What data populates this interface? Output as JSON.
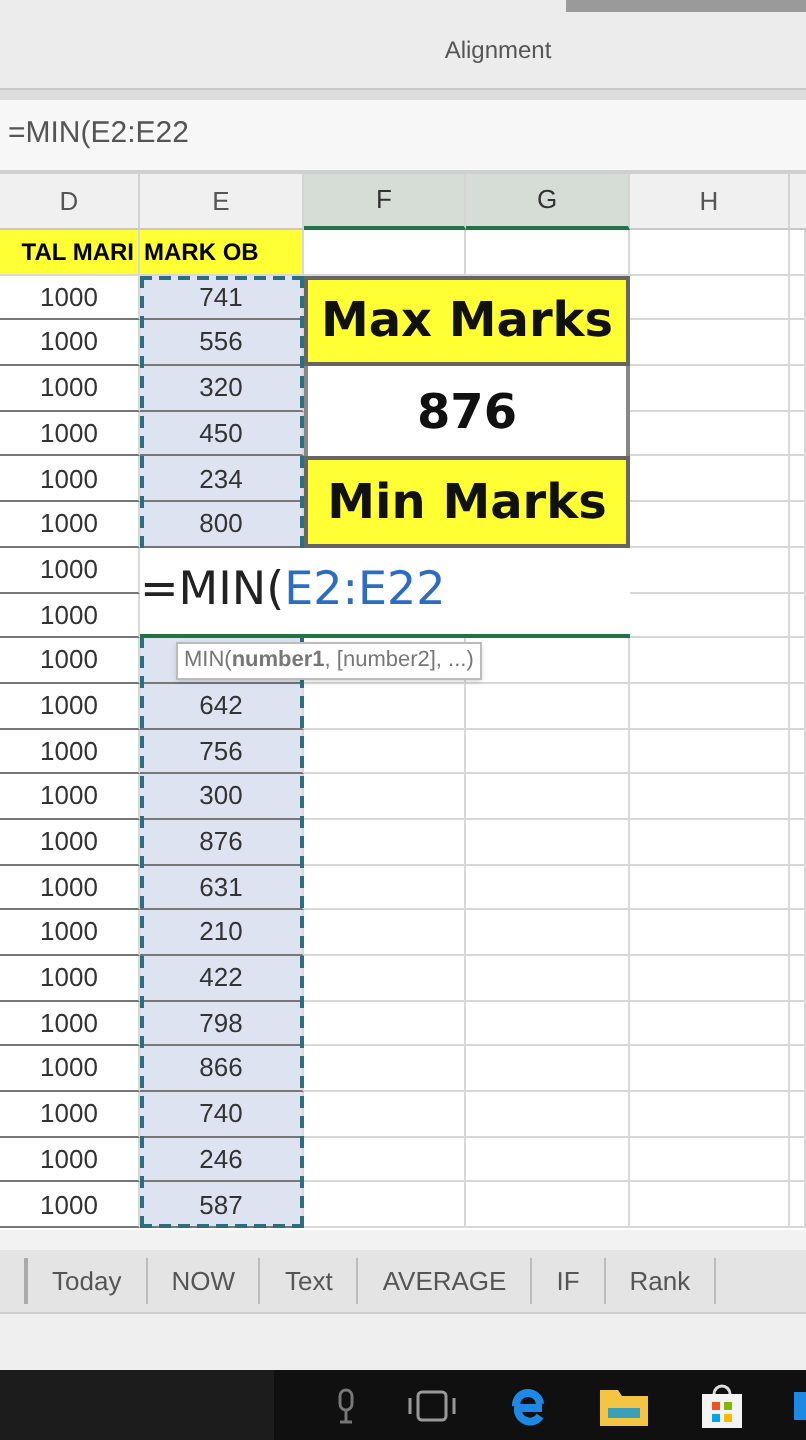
{
  "ribbon": {
    "group_label": "Alignment"
  },
  "formula_bar": {
    "value": "=MIN(E2:E22"
  },
  "columns": [
    {
      "label": "D",
      "selected": false
    },
    {
      "label": "E",
      "selected": false
    },
    {
      "label": "F",
      "selected": true
    },
    {
      "label": "G",
      "selected": true
    },
    {
      "label": "H",
      "selected": false
    }
  ],
  "header_row": [
    "TAL MARI",
    "MARK OB"
  ],
  "rows": [
    {
      "total": "1000",
      "marks": "741"
    },
    {
      "total": "1000",
      "marks": "556"
    },
    {
      "total": "1000",
      "marks": "320"
    },
    {
      "total": "1000",
      "marks": "450"
    },
    {
      "total": "1000",
      "marks": "234"
    },
    {
      "total": "1000",
      "marks": "800"
    },
    {
      "total": "1000"
    },
    {
      "total": "1000"
    },
    {
      "total": "1000"
    },
    {
      "total": "1000",
      "marks": "642"
    },
    {
      "total": "1000",
      "marks": "756"
    },
    {
      "total": "1000",
      "marks": "300"
    },
    {
      "total": "1000",
      "marks": "876"
    },
    {
      "total": "1000",
      "marks": "631"
    },
    {
      "total": "1000",
      "marks": "210"
    },
    {
      "total": "1000",
      "marks": "422"
    },
    {
      "total": "1000",
      "marks": "798"
    },
    {
      "total": "1000",
      "marks": "866"
    },
    {
      "total": "1000",
      "marks": "740"
    },
    {
      "total": "1000",
      "marks": "246"
    },
    {
      "total": "1000",
      "marks": "587"
    }
  ],
  "summary": [
    {
      "kind": "label",
      "text": "Max Marks"
    },
    {
      "kind": "value",
      "text": "876"
    },
    {
      "kind": "label",
      "text": "Min Marks"
    }
  ],
  "edit_cell": {
    "formula": "=MIN(",
    "range": "E2:E22"
  },
  "tooltip": {
    "text": "MIN(**number1**, [number2], ...)"
  },
  "sheet_tabs": [
    {
      "label": "Today",
      "selected": false
    },
    {
      "label": "NOW",
      "selected": false
    },
    {
      "label": "Text",
      "selected": false
    },
    {
      "label": "AVERAGE",
      "selected": false
    },
    {
      "label": "IF",
      "selected": false
    },
    {
      "label": "Rank",
      "selected": false
    }
  ]
}
